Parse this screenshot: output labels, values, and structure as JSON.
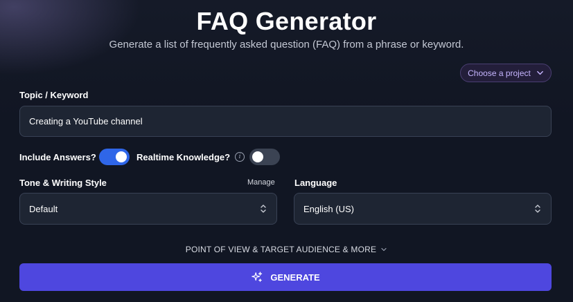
{
  "header": {
    "title": "FAQ Generator",
    "subtitle": "Generate a list of frequently asked question (FAQ) from a phrase or keyword."
  },
  "project_selector": {
    "label": "Choose a project",
    "icon": "chevron-down-icon"
  },
  "topic": {
    "label": "Topic / Keyword",
    "value": "Creating a YouTube channel"
  },
  "toggles": {
    "include_answers": {
      "label": "Include Answers?",
      "on": true
    },
    "realtime_knowledge": {
      "label": "Realtime Knowledge?",
      "on": false,
      "info_icon": "info-icon",
      "info_glyph": "i"
    }
  },
  "tone": {
    "label": "Tone & Writing Style",
    "manage_label": "Manage",
    "value": "Default"
  },
  "language": {
    "label": "Language",
    "value": "English (US)"
  },
  "more_options": {
    "label": "POINT OF VIEW & TARGET AUDIENCE & MORE",
    "icon": "chevron-down-icon"
  },
  "generate": {
    "label": "GENERATE",
    "icon": "sparkles-icon"
  },
  "colors": {
    "background": "#111623",
    "accent": "#4e47df",
    "toggle_on": "#2f66e8",
    "project_text": "#c6b5ff"
  }
}
